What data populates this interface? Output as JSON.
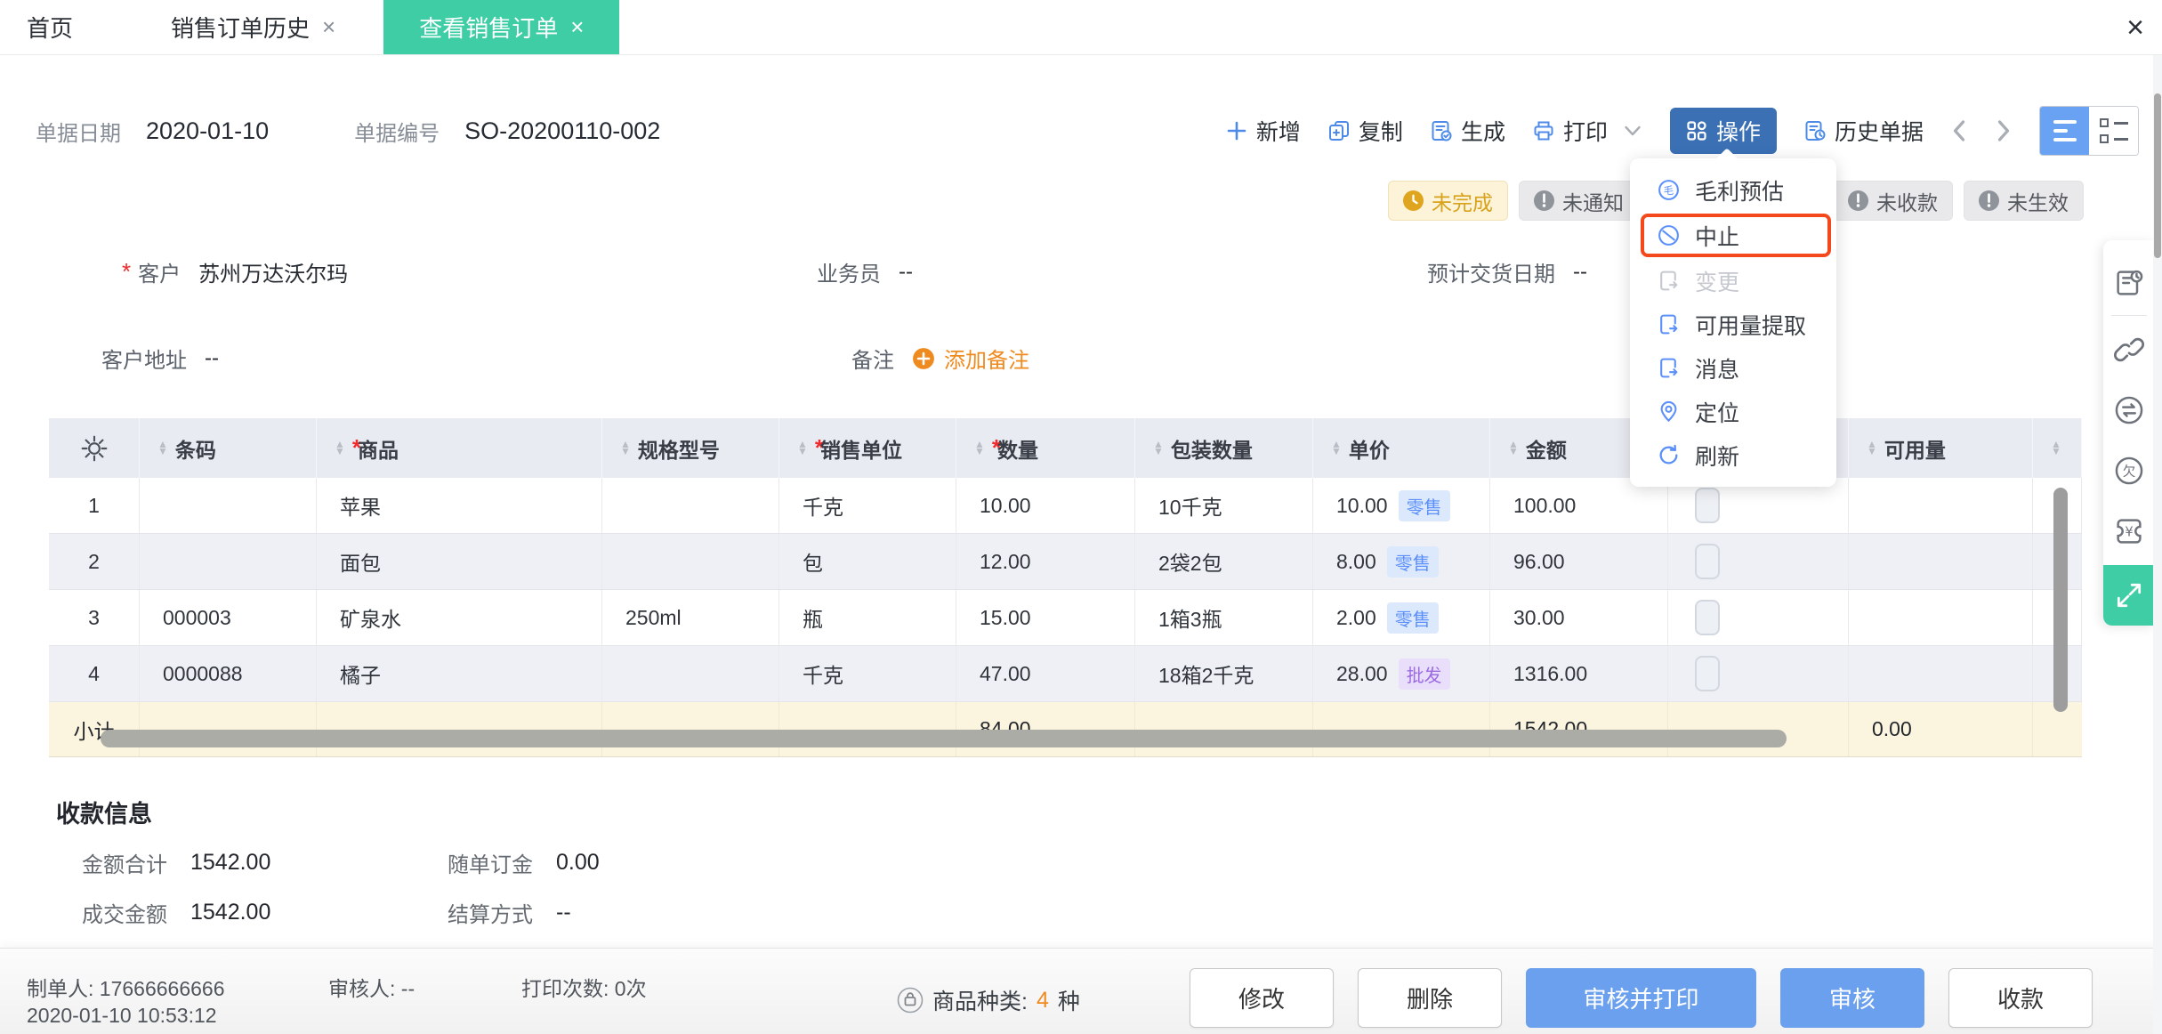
{
  "ui": {
    "required_mark": "*",
    "close_glyph": "×"
  },
  "tabs": [
    {
      "label": "首页",
      "active": false,
      "closable": false
    },
    {
      "label": "销售订单历史",
      "active": false,
      "closable": true
    },
    {
      "label": "查看销售订单",
      "active": true,
      "closable": true
    }
  ],
  "doc_header": {
    "date_label": "单据日期",
    "date_value": "2020-01-10",
    "no_label": "单据编号",
    "no_value": "SO-20200110-002"
  },
  "toolbar": {
    "add_label": "新增",
    "copy_label": "复制",
    "generate_label": "生成",
    "print_label": "打印",
    "action_label": "操作",
    "history_label": "历史单据"
  },
  "action_menu": {
    "items": [
      {
        "label": "毛利预估",
        "icon": "profit-icon",
        "state": "normal"
      },
      {
        "label": "中止",
        "icon": "stop-icon",
        "state": "highlighted"
      },
      {
        "label": "变更",
        "icon": "change-icon",
        "state": "disabled"
      },
      {
        "label": "可用量提取",
        "icon": "extract-icon",
        "state": "normal"
      },
      {
        "label": "消息",
        "icon": "message-icon",
        "state": "normal"
      },
      {
        "label": "定位",
        "icon": "locate-icon",
        "state": "normal"
      },
      {
        "label": "刷新",
        "icon": "refresh-icon",
        "state": "normal"
      }
    ]
  },
  "status_badges": [
    {
      "label": "未完成",
      "type": "warning",
      "icon": "clock-icon"
    },
    {
      "label": "未通知",
      "type": "default",
      "icon": "exclamation-icon"
    },
    {
      "label": "未收款",
      "type": "default",
      "icon": "exclamation-icon"
    },
    {
      "label": "未生效",
      "type": "default",
      "icon": "exclamation-icon"
    }
  ],
  "form": {
    "customer_label": "客户",
    "customer_value": "苏州万达沃尔玛",
    "salesman_label": "业务员",
    "salesman_value": "--",
    "delivery_label": "预计交货日期",
    "delivery_value": "--",
    "address_label": "客户地址",
    "address_value": "--",
    "remark_label": "备注",
    "add_remark_label": "添加备注"
  },
  "table": {
    "columns": [
      {
        "label": "条码",
        "required": false
      },
      {
        "label": "商品",
        "required": true
      },
      {
        "label": "规格型号",
        "required": false
      },
      {
        "label": "销售单位",
        "required": true
      },
      {
        "label": "数量",
        "required": true
      },
      {
        "label": "包装数量",
        "required": false
      },
      {
        "label": "单价",
        "required": false
      },
      {
        "label": "金额",
        "required": false
      },
      {
        "label": "",
        "required": false
      },
      {
        "label": "可用量",
        "required": false
      }
    ],
    "rows": [
      {
        "no": "1",
        "barcode": "",
        "product": "苹果",
        "spec": "",
        "unit": "千克",
        "qty": "10.00",
        "pack_qty": "10千克",
        "price": "10.00",
        "price_tag": "零售",
        "amount": "100.00",
        "available": ""
      },
      {
        "no": "2",
        "barcode": "",
        "product": "面包",
        "spec": "",
        "unit": "包",
        "qty": "12.00",
        "pack_qty": "2袋2包",
        "price": "8.00",
        "price_tag": "零售",
        "amount": "96.00",
        "available": ""
      },
      {
        "no": "3",
        "barcode": "000003",
        "product": "矿泉水",
        "spec": "250ml",
        "unit": "瓶",
        "qty": "15.00",
        "pack_qty": "1箱3瓶",
        "price": "2.00",
        "price_tag": "零售",
        "amount": "30.00",
        "available": ""
      },
      {
        "no": "4",
        "barcode": "0000088",
        "product": "橘子",
        "spec": "",
        "unit": "千克",
        "qty": "47.00",
        "pack_qty": "18箱2千克",
        "price": "28.00",
        "price_tag": "批发",
        "amount": "1316.00",
        "available": ""
      }
    ],
    "subtotal": {
      "label": "小计",
      "qty": "84.00",
      "amount": "1542.00",
      "available": "0.00"
    }
  },
  "payment": {
    "title": "收款信息",
    "total_label": "金额合计",
    "total_value": "1542.00",
    "deposit_label": "随单订金",
    "deposit_value": "0.00",
    "deal_label": "成交金额",
    "deal_value": "1542.00",
    "settle_label": "结算方式",
    "settle_value": "--"
  },
  "footer": {
    "creator_label": "制单人:",
    "creator_value": "17666666666",
    "created_time": "2020-01-10 10:53:12",
    "auditor_label": "审核人:",
    "auditor_value": "--",
    "print_label": "打印次数:",
    "print_value": "0次",
    "category_label": "商品种类:",
    "category_count": "4",
    "category_unit": "种",
    "buttons": [
      {
        "label": "修改",
        "style": "outline"
      },
      {
        "label": "删除",
        "style": "outline"
      },
      {
        "label": "审核并打印",
        "style": "primary"
      },
      {
        "label": "审核",
        "style": "primary"
      },
      {
        "label": "收款",
        "style": "outline"
      }
    ]
  },
  "sidebar_icons": [
    "order-doc-icon",
    "link-icon",
    "exchange-icon",
    "arrears-icon",
    "money-ticket-icon",
    "expand-icon"
  ],
  "colors": {
    "accent_teal": "#3ECDA5",
    "toolbar_icon_blue": "#4E8BE8",
    "action_button_blue": "#3B70B5",
    "primary_button_blue": "#6AA0ED",
    "highlight_red": "#F4491C",
    "warning_badge_text": "#D8A21B",
    "retail_tag_blue": "#5B8FF9",
    "wholesale_tag_purple": "#9B6BE3",
    "orange_accent": "#EF8A1F",
    "table_header_bg": "#E9EBF2",
    "subtotal_bg": "#FBF5DF"
  }
}
